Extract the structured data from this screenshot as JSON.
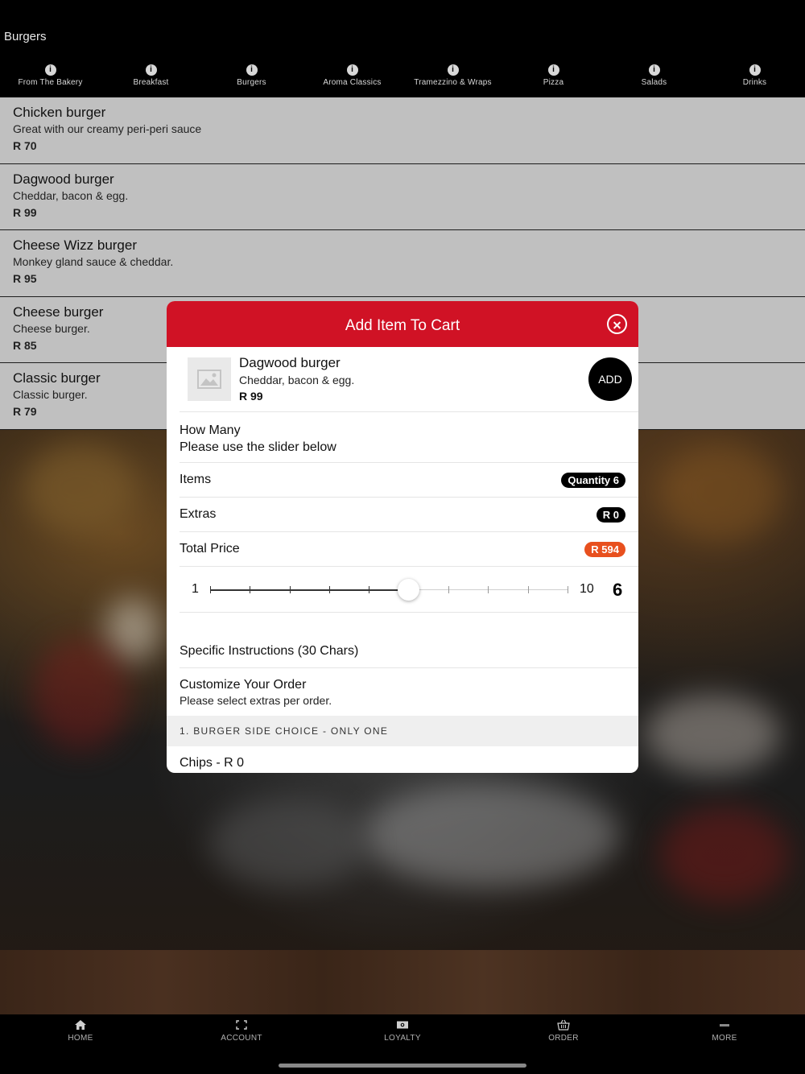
{
  "header": {
    "title": "Burgers"
  },
  "categories": [
    {
      "label": "From The Bakery"
    },
    {
      "label": "Breakfast"
    },
    {
      "label": "Burgers"
    },
    {
      "label": "Aroma Classics"
    },
    {
      "label": "Tramezzino & Wraps"
    },
    {
      "label": "Pizza"
    },
    {
      "label": "Salads"
    },
    {
      "label": "Drinks"
    }
  ],
  "menu_items": [
    {
      "name": "Chicken burger",
      "description": "Great with our creamy peri-peri sauce",
      "price": "R 70"
    },
    {
      "name": "Dagwood burger",
      "description": "Cheddar, bacon & egg.",
      "price": "R 99"
    },
    {
      "name": "Cheese Wizz burger",
      "description": "Monkey gland sauce & cheddar.",
      "price": "R 95"
    },
    {
      "name": "Cheese burger",
      "description": "Cheese burger.",
      "price": "R 85"
    },
    {
      "name": "Classic burger",
      "description": "Classic burger.",
      "price": "R 79"
    }
  ],
  "modal": {
    "title": "Add Item To Cart",
    "item": {
      "name": "Dagwood burger",
      "description": "Cheddar, bacon & egg.",
      "price": "R 99"
    },
    "add_label": "ADD",
    "how_many_title": "How Many",
    "how_many_hint": "Please use the slider below",
    "items_label": "Items",
    "items_badge": "Quantity 6",
    "extras_label": "Extras",
    "extras_badge": "R 0",
    "total_label": "Total Price",
    "total_badge": "R 594",
    "slider": {
      "min": 1,
      "max": 10,
      "value": 6,
      "min_label": "1",
      "max_label": "10",
      "value_label": "6"
    },
    "instructions_label": "Specific Instructions (30 Chars)",
    "customize_title": "Customize Your Order",
    "customize_hint": "Please select extras per order.",
    "group_title": "1. BURGER SIDE CHOICE - ONLY ONE",
    "first_option": "Chips - R 0"
  },
  "tabs": [
    {
      "label": "HOME",
      "icon": "home-icon"
    },
    {
      "label": "ACCOUNT",
      "icon": "scan-icon"
    },
    {
      "label": "LOYALTY",
      "icon": "money-icon"
    },
    {
      "label": "ORDER",
      "icon": "basket-icon"
    },
    {
      "label": "MORE",
      "icon": "more-icon"
    }
  ],
  "colors": {
    "header_red": "#d01225",
    "total_badge": "#e8501e",
    "badge_dark": "#000000",
    "list_row": "#c0c0c0"
  }
}
